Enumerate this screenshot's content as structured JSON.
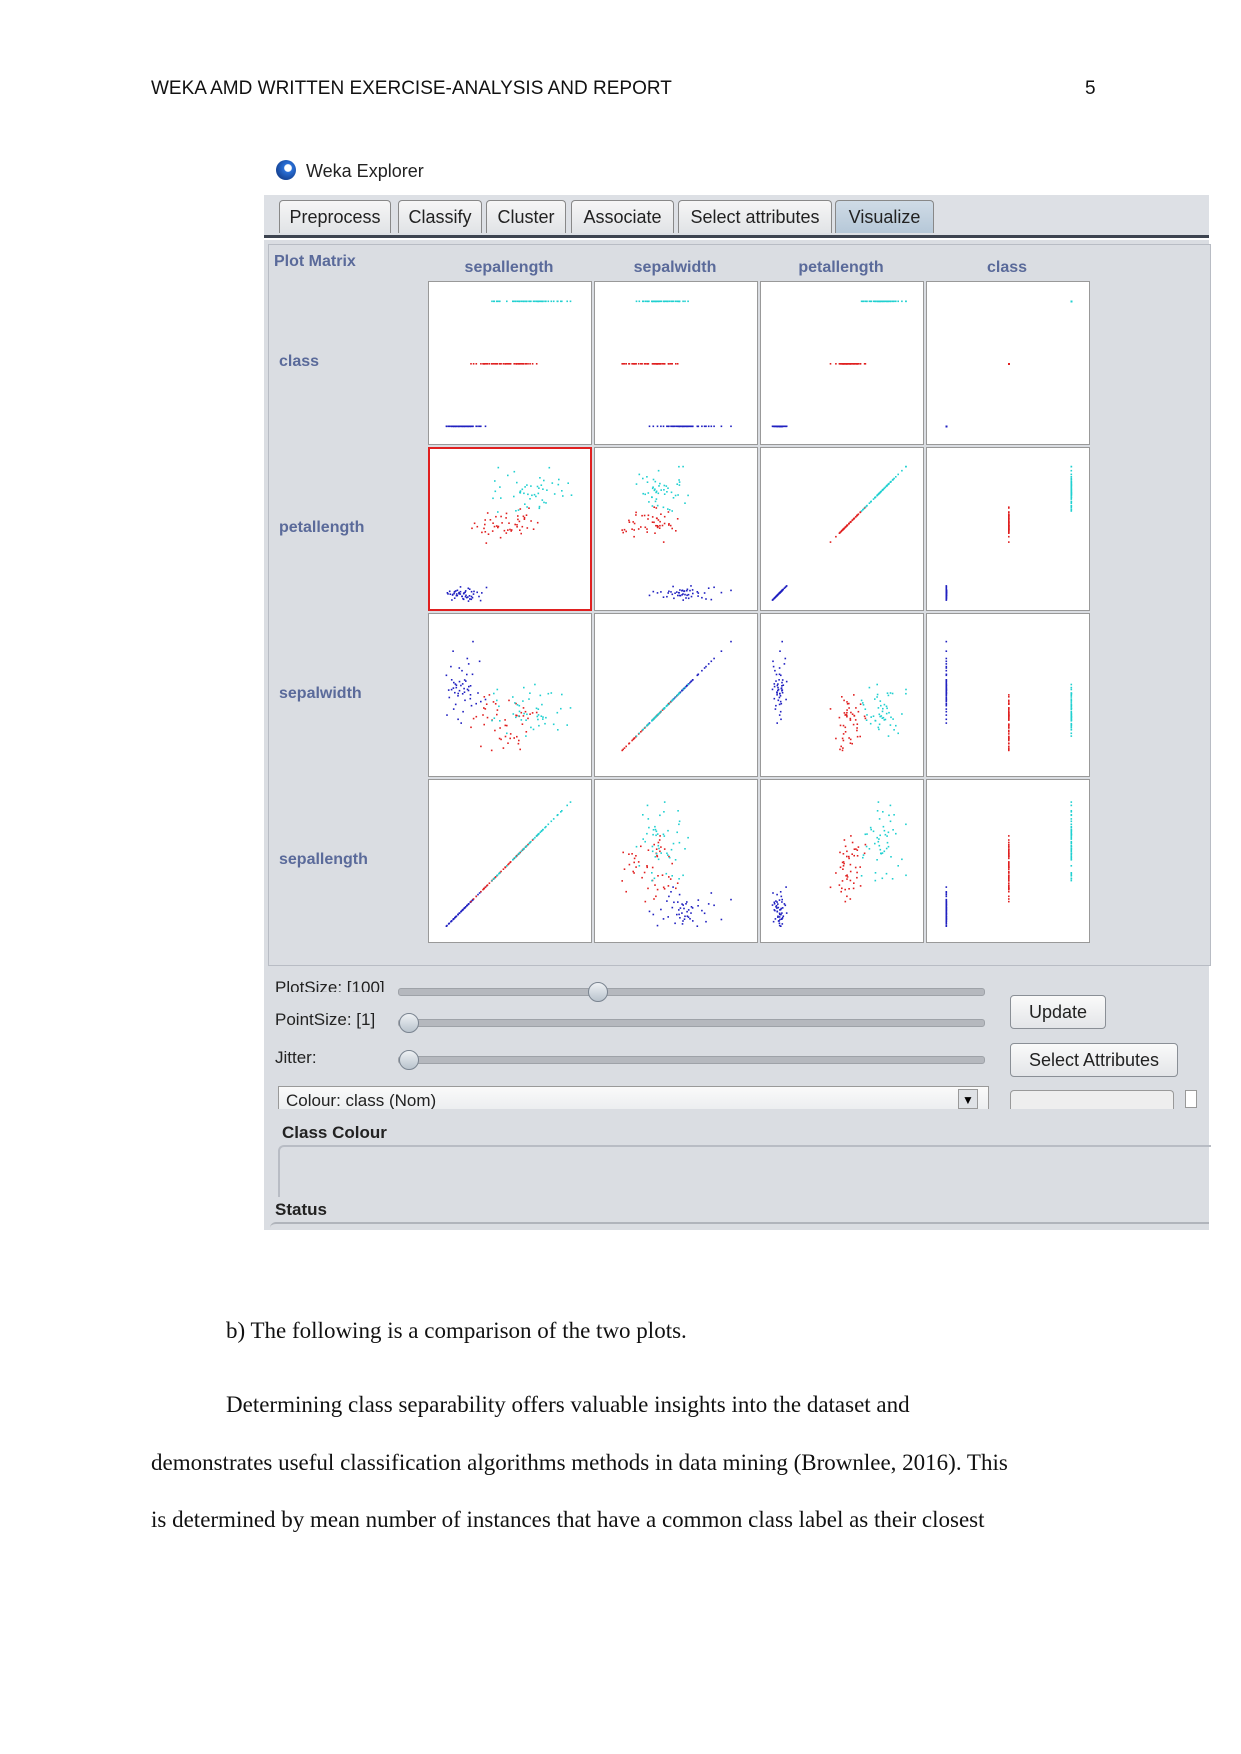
{
  "header": {
    "running_head": "WEKA AMD WRITTEN EXERCISE-ANALYSIS AND REPORT",
    "page_number": "5"
  },
  "window": {
    "title": "Weka Explorer",
    "icon": "weka-bird-icon"
  },
  "tabs": [
    {
      "label": "Preprocess"
    },
    {
      "label": "Classify"
    },
    {
      "label": "Cluster"
    },
    {
      "label": "Associate"
    },
    {
      "label": "Select attributes"
    },
    {
      "label": "Visualize",
      "active": true
    }
  ],
  "matrix": {
    "title": "Plot Matrix",
    "columns": [
      "sepallength",
      "sepalwidth",
      "petallength",
      "class"
    ],
    "rows": [
      "class",
      "petallength",
      "sepalwidth",
      "sepallength"
    ],
    "selected_cell": "petallength vs sepallength",
    "class_colors": [
      "#2020c0",
      "#e02020",
      "#20d0d0"
    ]
  },
  "controls": {
    "plotsize_label": "PlotSize: [100]",
    "pointsize_label": "PointSize: [1]",
    "jitter_label": "Jitter:",
    "plotsize_value": 100,
    "pointsize_value": 1,
    "jitter_value": 0,
    "update_label": "Update",
    "select_attributes_label": "Select Attributes",
    "colour_combo": "Colour: class  (Nom)",
    "class_colour_label": "Class Colour",
    "status_label": "Status"
  },
  "body": {
    "item_b": "b)   The following is a comparison of the two plots.",
    "p1": "Determining class separability offers valuable insights into the dataset and",
    "p2": "demonstrates useful classification algorithms methods in data mining (Brownlee, 2016). This",
    "p3": "is determined by mean number of instances that have a common class label as their closest"
  }
}
